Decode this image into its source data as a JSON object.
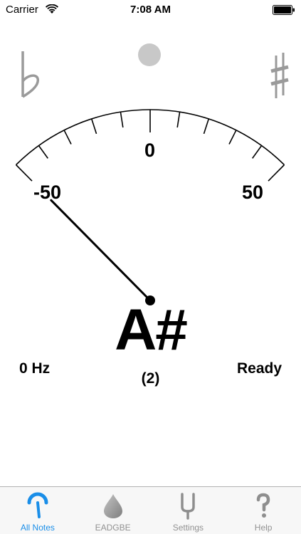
{
  "status_bar": {
    "carrier": "Carrier",
    "time": "7:08 AM"
  },
  "tuner": {
    "scale_zero": "0",
    "scale_min": "-50",
    "scale_max": "50",
    "note": "A#",
    "octave": "(2)",
    "frequency": "0 Hz",
    "status": "Ready",
    "needle_cents": -50
  },
  "tab_bar": {
    "tabs": [
      {
        "label": "All Notes",
        "icon": "gauge-icon",
        "active": true
      },
      {
        "label": "EADGBE",
        "icon": "pick-icon",
        "active": false
      },
      {
        "label": "Settings",
        "icon": "tuning-fork-icon",
        "active": false
      },
      {
        "label": "Help",
        "icon": "question-icon",
        "active": false
      }
    ]
  },
  "colors": {
    "accent": "#1a8ee8",
    "inactive": "#929292",
    "indicator": "#c8c8c8"
  }
}
